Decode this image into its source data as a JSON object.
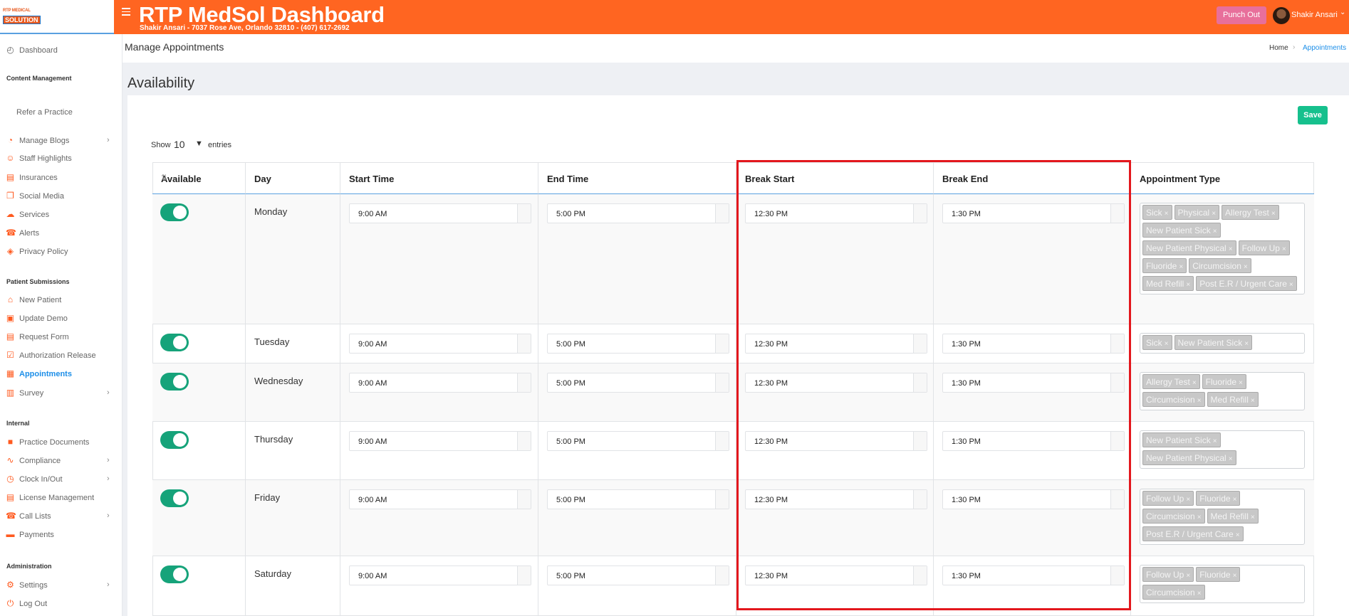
{
  "header": {
    "logo_line1": "RTP MEDICAL",
    "logo_line2": "SOLUTION",
    "title": "RTP MedSol Dashboard",
    "subtitle": "Shakir Ansari - 7037 Rose Ave, Orlando 32810 - (407) 617-2692",
    "punch_label": "Punch Out",
    "user_name": "Shakir Ansari",
    "accent_color": "#ff6521"
  },
  "sidebar": {
    "dashboard": "Dashboard",
    "sections": {
      "content": "Content Management",
      "patient": "Patient Submissions",
      "internal": "Internal",
      "admin": "Administration"
    },
    "items": [
      {
        "label": "Refer a Practice",
        "icon": "none"
      },
      {
        "label": "Manage Blogs",
        "icon": "rss-icon"
      },
      {
        "label": "Staff Highlights",
        "icon": "user-icon"
      },
      {
        "label": "Insurances",
        "icon": "document-icon"
      },
      {
        "label": "Social Media",
        "icon": "share-icon"
      },
      {
        "label": "Services",
        "icon": "cloud-icon"
      },
      {
        "label": "Alerts",
        "icon": "phone-icon"
      },
      {
        "label": "Privacy Policy",
        "icon": "shield-icon"
      },
      {
        "label": "New Patient",
        "icon": "home-icon"
      },
      {
        "label": "Update Demo",
        "icon": "id-card-icon"
      },
      {
        "label": "Request Form",
        "icon": "form-icon"
      },
      {
        "label": "Authorization Release",
        "icon": "clipboard-check-icon"
      },
      {
        "label": "Appointments",
        "icon": "calendar-icon"
      },
      {
        "label": "Survey",
        "icon": "clipboard-icon"
      },
      {
        "label": "Practice Documents",
        "icon": "folder-icon"
      },
      {
        "label": "Compliance",
        "icon": "chart-icon"
      },
      {
        "label": "Clock In/Out",
        "icon": "clock-icon"
      },
      {
        "label": "License Management",
        "icon": "license-icon"
      },
      {
        "label": "Call Lists",
        "icon": "phone-icon"
      },
      {
        "label": "Payments",
        "icon": "money-icon"
      },
      {
        "label": "Settings",
        "icon": "gear-icon"
      },
      {
        "label": "Log Out",
        "icon": "power-icon"
      }
    ]
  },
  "page": {
    "title": "Manage Appointments",
    "breadcrumb": [
      "Home",
      "Appointments"
    ],
    "section_title": "Availability",
    "save_label": "Save",
    "show_label": "Show",
    "show_value": "10",
    "entries_label": "entries"
  },
  "table": {
    "columns": [
      "Available",
      "Day",
      "Start Time",
      "End Time",
      "Break Start",
      "Break End",
      "Appointment Type"
    ],
    "rows": [
      {
        "day": "Monday",
        "available": true,
        "start": "9:00 AM",
        "end": "5:00 PM",
        "break_start": "12:30 PM",
        "break_end": "1:30 PM",
        "types": [
          "Sick",
          "Physical",
          "Allergy Test",
          "New Patient Sick",
          "New Patient Physical",
          "Follow Up",
          "Fluoride",
          "Circumcision",
          "Med Refill",
          "Post E.R / Urgent Care"
        ]
      },
      {
        "day": "Tuesday",
        "available": true,
        "start": "9:00 AM",
        "end": "5:00 PM",
        "break_start": "12:30 PM",
        "break_end": "1:30 PM",
        "types": [
          "Sick",
          "New Patient Sick"
        ]
      },
      {
        "day": "Wednesday",
        "available": true,
        "start": "9:00 AM",
        "end": "5:00 PM",
        "break_start": "12:30 PM",
        "break_end": "1:30 PM",
        "types": [
          "Allergy Test",
          "Fluoride",
          "Circumcision",
          "Med Refill"
        ]
      },
      {
        "day": "Thursday",
        "available": true,
        "start": "9:00 AM",
        "end": "5:00 PM",
        "break_start": "12:30 PM",
        "break_end": "1:30 PM",
        "types": [
          "New Patient Sick",
          "New Patient Physical"
        ]
      },
      {
        "day": "Friday",
        "available": true,
        "start": "9:00 AM",
        "end": "5:00 PM",
        "break_start": "12:30 PM",
        "break_end": "1:30 PM",
        "types": [
          "Follow Up",
          "Fluoride",
          "Circumcision",
          "Med Refill",
          "Post E.R / Urgent Care"
        ]
      },
      {
        "day": "Saturday",
        "available": true,
        "start": "9:00 AM",
        "end": "5:00 PM",
        "break_start": "12:30 PM",
        "break_end": "1:30 PM",
        "types": [
          "Follow Up",
          "Fluoride",
          "Circumcision"
        ]
      }
    ]
  }
}
